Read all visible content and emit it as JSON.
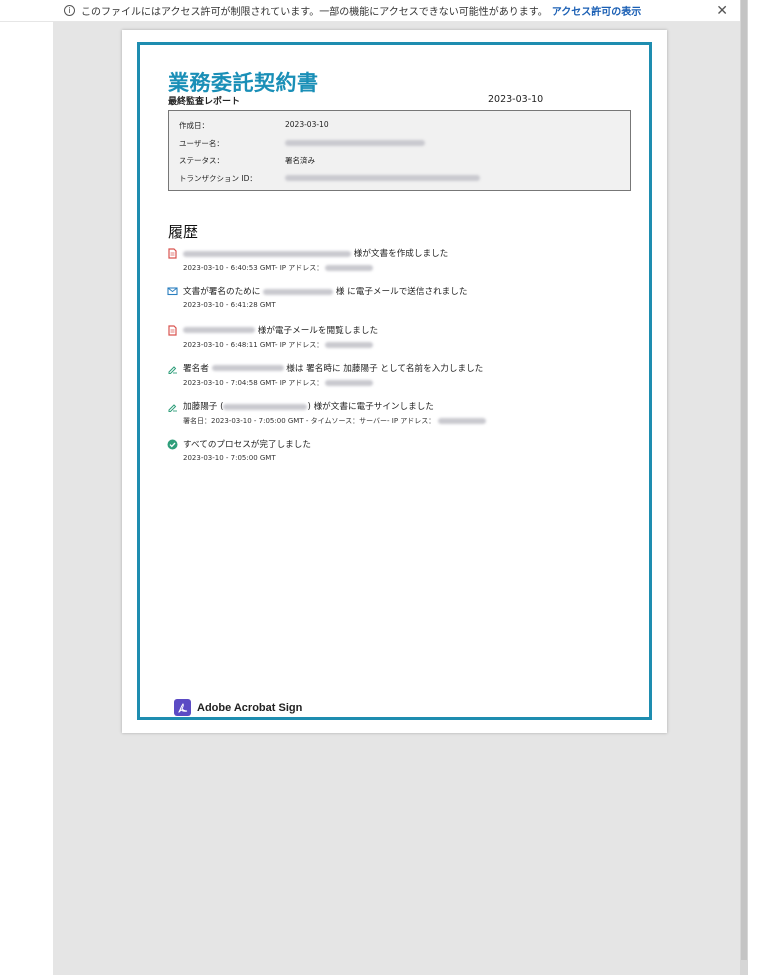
{
  "infobar": {
    "message": "このファイルにはアクセス許可が制限されています。一部の機能にアクセスできない可能性があります。",
    "link": "アクセス許可の表示",
    "close": "✕"
  },
  "document": {
    "title": "業務委託契約書",
    "subtitle": "最終監査レポート",
    "date": "2023-03-10",
    "meta": [
      {
        "label": "作成日：",
        "value": "2023-03-10"
      },
      {
        "label": "ユーザー名：",
        "value": ""
      },
      {
        "label": "ステータス：",
        "value": "署名済み"
      },
      {
        "label": "トランザクション ID：",
        "value": ""
      }
    ],
    "history_title": "履歴",
    "events": [
      {
        "icon": "document-icon",
        "before": "",
        "after": "様が文書を作成しました",
        "detail": "2023-03-10 - 6:40:53 GMT- IP アドレス："
      },
      {
        "icon": "email-icon",
        "before": "文書が署名のために",
        "after": "様 に電子メールで送信されました",
        "detail": "2023-03-10 - 6:41:28 GMT"
      },
      {
        "icon": "document-icon",
        "before": "",
        "after": "様が電子メールを閲覧しました",
        "detail": "2023-03-10 - 6:48:11 GMT- IP アドレス："
      },
      {
        "icon": "signature-icon",
        "before": "署名者",
        "after": "様は 署名時に 加藤陽子 として名前を入力しました",
        "detail": "2023-03-10 - 7:04:58 GMT- IP アドレス："
      },
      {
        "icon": "signature-icon",
        "before": "加藤陽子 (",
        "after": "様が文書に電子サインしました",
        "detail": "署名日：2023-03-10 - 7:05:00 GMT - タイムソース：サーバー- IP アドレス："
      },
      {
        "icon": "check-icon",
        "before": "すべてのプロセスが完了しました",
        "after": "",
        "detail": "2023-03-10 - 7:05:00 GMT"
      }
    ],
    "brand": "Adobe Acrobat Sign"
  },
  "colors": {
    "accent": "#1a8fb7",
    "frame": "#1e8db0",
    "brand": "#5b4bc4",
    "document_icon": "#d9534f",
    "check": "#2e9e7a"
  }
}
